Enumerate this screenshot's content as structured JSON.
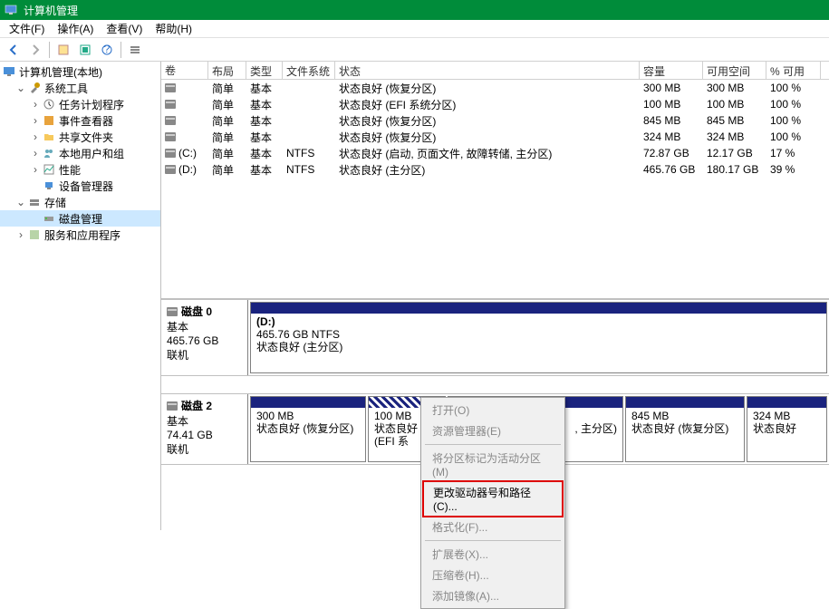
{
  "window": {
    "title": "计算机管理"
  },
  "menu": [
    "文件(F)",
    "操作(A)",
    "查看(V)",
    "帮助(H)"
  ],
  "tree": {
    "root": "计算机管理(本地)",
    "system_tools": "系统工具",
    "task_scheduler": "任务计划程序",
    "event_viewer": "事件查看器",
    "shared_folders": "共享文件夹",
    "local_users": "本地用户和组",
    "performance": "性能",
    "device_manager": "设备管理器",
    "storage": "存储",
    "disk_mgmt": "磁盘管理",
    "services": "服务和应用程序"
  },
  "columns": {
    "vol": "卷",
    "layout": "布局",
    "type": "类型",
    "fs": "文件系统",
    "status": "状态",
    "cap": "容量",
    "free": "可用空间",
    "pct": "% 可用"
  },
  "volumes": [
    {
      "vol": "",
      "layout": "简单",
      "type": "基本",
      "fs": "",
      "status": "状态良好 (恢复分区)",
      "cap": "300 MB",
      "free": "300 MB",
      "pct": "100 %"
    },
    {
      "vol": "",
      "layout": "简单",
      "type": "基本",
      "fs": "",
      "status": "状态良好 (EFI 系统分区)",
      "cap": "100 MB",
      "free": "100 MB",
      "pct": "100 %"
    },
    {
      "vol": "",
      "layout": "简单",
      "type": "基本",
      "fs": "",
      "status": "状态良好 (恢复分区)",
      "cap": "845 MB",
      "free": "845 MB",
      "pct": "100 %"
    },
    {
      "vol": "",
      "layout": "简单",
      "type": "基本",
      "fs": "",
      "status": "状态良好 (恢复分区)",
      "cap": "324 MB",
      "free": "324 MB",
      "pct": "100 %"
    },
    {
      "vol": "(C:)",
      "layout": "简单",
      "type": "基本",
      "fs": "NTFS",
      "status": "状态良好 (启动, 页面文件, 故障转储, 主分区)",
      "cap": "72.87 GB",
      "free": "12.17 GB",
      "pct": "17 %"
    },
    {
      "vol": "(D:)",
      "layout": "简单",
      "type": "基本",
      "fs": "NTFS",
      "status": "状态良好 (主分区)",
      "cap": "465.76 GB",
      "free": "180.17 GB",
      "pct": "39 %"
    }
  ],
  "disk0": {
    "name": "磁盘 0",
    "type": "基本",
    "size": "465.76 GB",
    "status": "联机",
    "part_d_label": "(D:)",
    "part_d_size": "465.76 GB NTFS",
    "part_d_status": "状态良好 (主分区)"
  },
  "disk2": {
    "name": "磁盘 2",
    "type": "基本",
    "size": "74.41 GB",
    "status": "联机",
    "p1_size": "300 MB",
    "p1_status": "状态良好 (恢复分区)",
    "p2_size": "100 MB",
    "p2_status": "状态良好 (EFI 系",
    "p3_status": ", 主分区)",
    "p4_size": "845 MB",
    "p4_status": "状态良好 (恢复分区)",
    "p5_size": "324 MB",
    "p5_status": "状态良好"
  },
  "ctx": {
    "open": "打开(O)",
    "explorer": "资源管理器(E)",
    "mark_active": "将分区标记为活动分区(M)",
    "change_letter": "更改驱动器号和路径(C)...",
    "format": "格式化(F)...",
    "extend": "扩展卷(X)...",
    "shrink": "压缩卷(H)...",
    "mirror": "添加镜像(A)..."
  }
}
